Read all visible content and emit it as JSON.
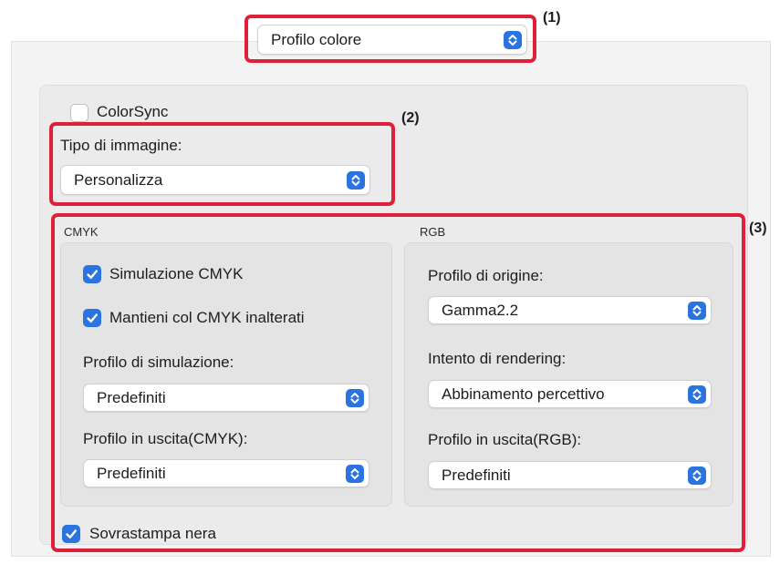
{
  "preset_menu": {
    "value": "Profilo colore"
  },
  "colorsync": {
    "label": "ColorSync",
    "checked": false
  },
  "image_type": {
    "label": "Tipo di immagine:",
    "value": "Personalizza"
  },
  "cmyk": {
    "title": "CMYK",
    "simulation": {
      "label": "Simulazione CMYK",
      "checked": true
    },
    "keep_cmyk": {
      "label": "Mantieni col CMYK inalterati",
      "checked": true
    },
    "simulation_profile": {
      "label": "Profilo di simulazione:",
      "value": "Predefiniti"
    },
    "output_profile": {
      "label": "Profilo in uscita(CMYK):",
      "value": "Predefiniti"
    }
  },
  "rgb": {
    "title": "RGB",
    "source_profile": {
      "label": "Profilo di origine:",
      "value": "Gamma2.2"
    },
    "rendering_intent": {
      "label": "Intento di rendering:",
      "value": "Abbinamento percettivo"
    },
    "output_profile": {
      "label": "Profilo in uscita(RGB):",
      "value": "Predefiniti"
    }
  },
  "overprint_black": {
    "label": "Sovrastampa nera",
    "checked": true
  },
  "callouts": [
    "(1)",
    "(2)",
    "(3)"
  ],
  "colors": {
    "accent": "#2a73e0",
    "callout": "#e0203b",
    "panel": "#f3f3f3"
  },
  "icons": {
    "popup": "chevron-updown-icon",
    "checkbox": "checkmark-icon"
  }
}
